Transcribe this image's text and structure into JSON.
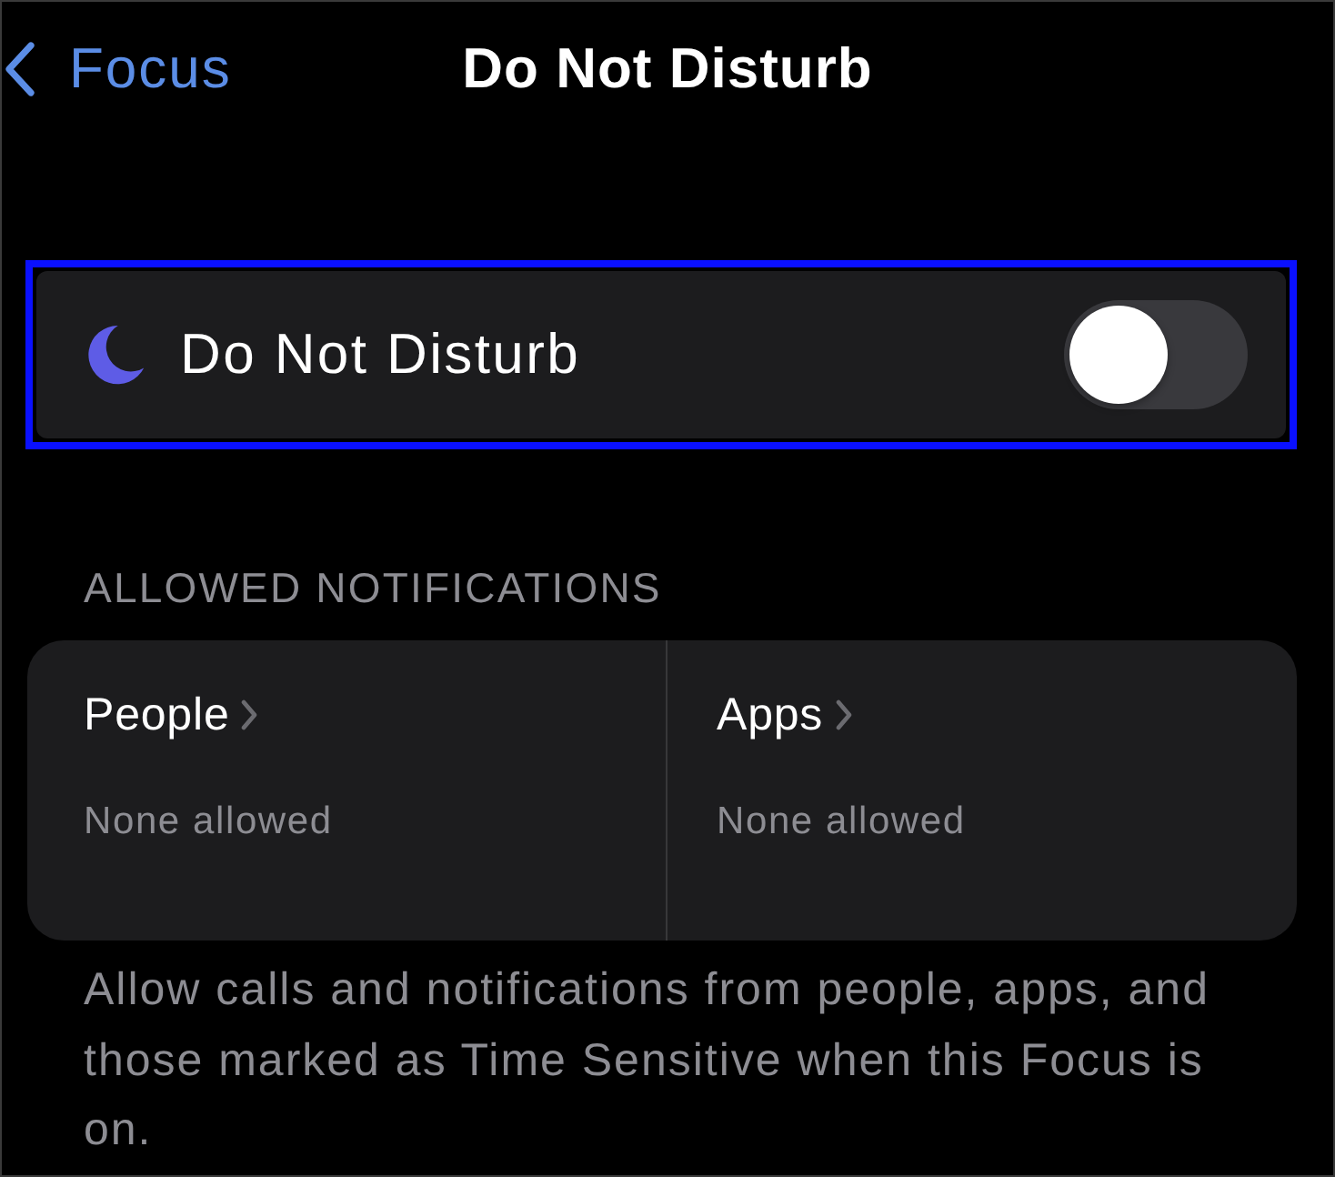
{
  "nav": {
    "back_label": "Focus",
    "title": "Do Not Disturb"
  },
  "focus_row": {
    "label": "Do Not Disturb",
    "on": false,
    "highlighted": true
  },
  "section": {
    "header": "ALLOWED NOTIFICATIONS",
    "items": [
      {
        "label": "People",
        "value": "None allowed"
      },
      {
        "label": "Apps",
        "value": "None allowed"
      }
    ],
    "footer": "Allow calls and notifications from people, apps, and those marked as Time Sensitive when this Focus is on."
  }
}
